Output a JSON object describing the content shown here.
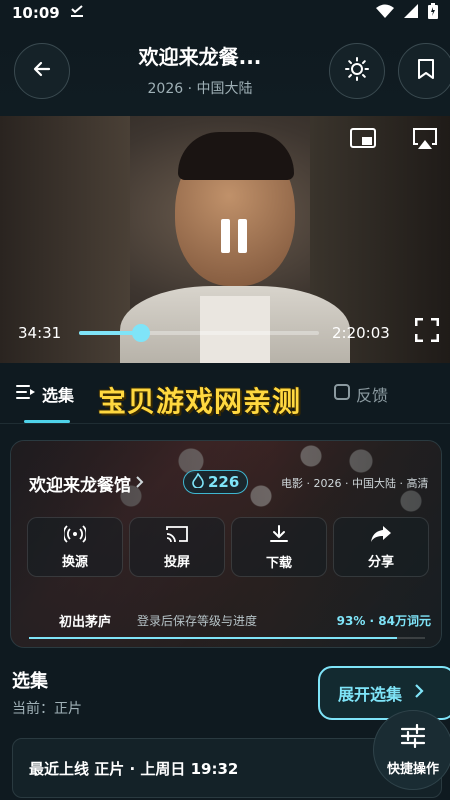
{
  "status_bar": {
    "time": "10:09"
  },
  "header": {
    "title": "欢迎来龙餐...",
    "subtitle": "2026 · 中国大陆"
  },
  "player": {
    "current_time": "34:31",
    "total_time": "2:20:03",
    "progress_fraction": 0.26
  },
  "tabs": [
    {
      "label": "选集"
    },
    {
      "label": "反馈"
    }
  ],
  "watermark": "宝贝游戏网亲测",
  "info": {
    "title": "欢迎来龙餐馆",
    "heat": "226",
    "meta": "电影 · 2026 · 中国大陆 · 高清",
    "actions": [
      {
        "label": "换源",
        "icon": "source-icon"
      },
      {
        "label": "投屏",
        "icon": "cast-icon"
      },
      {
        "label": "下载",
        "icon": "download-icon"
      },
      {
        "label": "分享",
        "icon": "share-icon"
      }
    ],
    "level": "初出茅庐",
    "level_hint": "登录后保存等级与进度",
    "level_stat": "93% · 84万词元",
    "level_fraction": 0.93
  },
  "episodes": {
    "title": "选集",
    "current": "当前：正片",
    "expand_label": "展开选集",
    "latest": "最近上线 正片 · 上周日 19:32"
  },
  "quick_action_label": "快捷操作",
  "colors": {
    "accent": "#7fe4f8",
    "background": "#0f1a20",
    "watermark": "#ffd840"
  }
}
